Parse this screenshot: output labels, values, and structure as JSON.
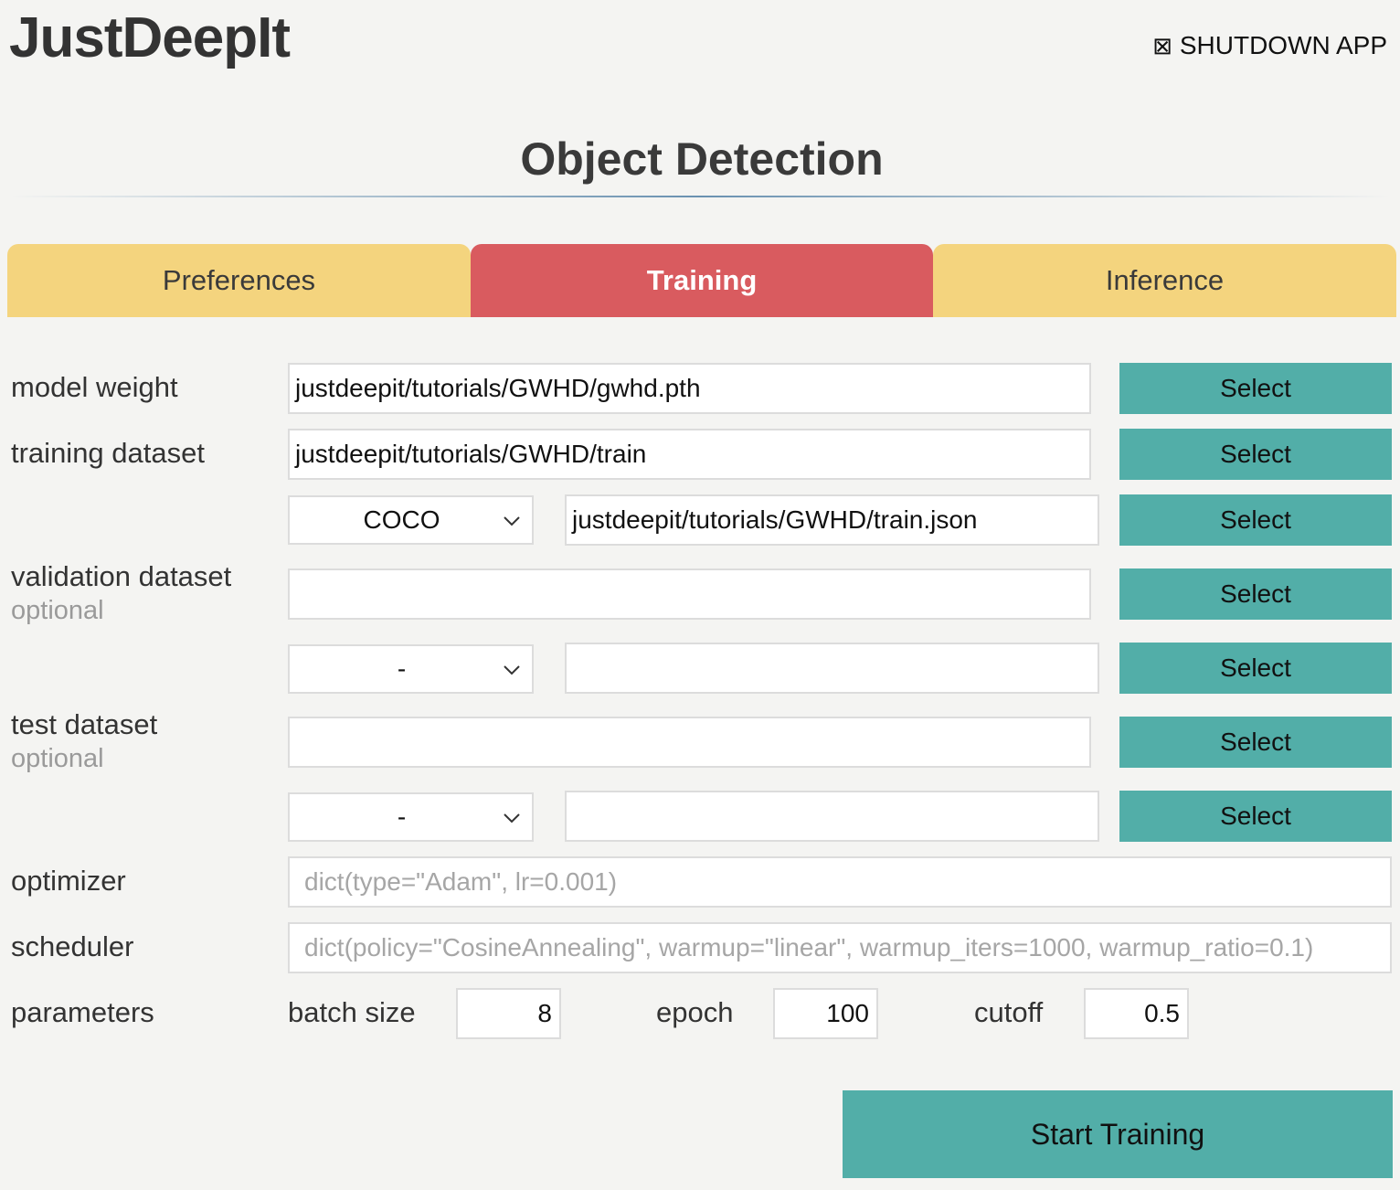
{
  "app": {
    "title": "JustDeepIt",
    "shutdown_label": "SHUTDOWN APP",
    "shutdown_icon": "⊠"
  },
  "page": {
    "title": "Object Detection"
  },
  "tabs": [
    {
      "label": "Preferences",
      "active": false
    },
    {
      "label": "Training",
      "active": true
    },
    {
      "label": "Inference",
      "active": false
    }
  ],
  "form": {
    "model_weight": {
      "label": "model weight",
      "value": "justdeepit/tutorials/GWHD/gwhd.pth",
      "button": "Select"
    },
    "training_dataset": {
      "label": "training dataset",
      "images_value": "justdeepit/tutorials/GWHD/train",
      "images_button": "Select",
      "format_value": "COCO",
      "annotation_value": "justdeepit/tutorials/GWHD/train.json",
      "annotation_button": "Select"
    },
    "validation_dataset": {
      "label": "validation dataset",
      "sublabel": "optional",
      "images_value": "",
      "images_button": "Select",
      "format_value": "-",
      "annotation_value": "",
      "annotation_button": "Select"
    },
    "test_dataset": {
      "label": "test dataset",
      "sublabel": "optional",
      "images_value": "",
      "images_button": "Select",
      "format_value": "-",
      "annotation_value": "",
      "annotation_button": "Select"
    },
    "optimizer": {
      "label": "optimizer",
      "placeholder": "dict(type=\"Adam\", lr=0.001)"
    },
    "scheduler": {
      "label": "scheduler",
      "placeholder": "dict(policy=\"CosineAnnealing\", warmup=\"linear\", warmup_iters=1000, warmup_ratio=0.1)"
    },
    "parameters": {
      "label": "parameters",
      "batch_size_label": "batch size",
      "batch_size": "8",
      "epoch_label": "epoch",
      "epoch": "100",
      "cutoff_label": "cutoff",
      "cutoff": "0.5"
    },
    "start_button": "Start Training"
  },
  "colors": {
    "tab_inactive": "#f4d47e",
    "tab_active": "#d95b5f",
    "button": "#52aea8",
    "background": "#f4f4f2"
  }
}
